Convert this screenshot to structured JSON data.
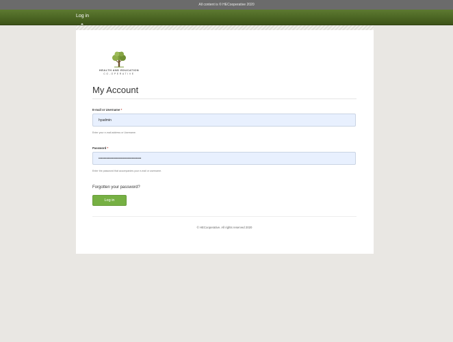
{
  "topbar": {
    "notice": "All content is © HECooperative 2020"
  },
  "nav": {
    "login_label": "Log in"
  },
  "logo": {
    "line1": "HEALTH AND EDUCATION",
    "line2": "CO-OPERATIVE",
    "icon": "tree-icon"
  },
  "page": {
    "title": "My Account"
  },
  "form": {
    "username_label": "E-mail or Username",
    "username_value": "hyadmin",
    "username_help": "Enter your e-mail address or Username.",
    "password_label": "Password",
    "password_value": "••••••••••••••••••••••••••••••••",
    "password_help": "Enter the password that accompanies your e-mail or username.",
    "required_marker": "*",
    "forgot_link": "Forgotten your password?",
    "submit_label": "Log in"
  },
  "footer": {
    "copyright": "© HECooperative. All rights reserved 2020"
  },
  "colors": {
    "nav_green": "#4a6322",
    "button_green": "#76b043",
    "field_bg": "#e8f0fe",
    "page_bg": "#e9e7e3"
  }
}
